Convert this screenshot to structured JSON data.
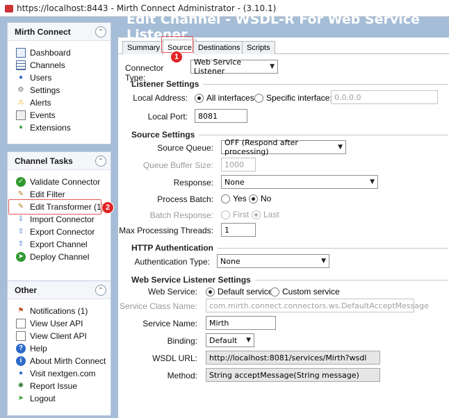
{
  "window": {
    "url": "https://localhost:8443",
    "separator": "-",
    "app_title": "Mirth Connect Administrator - (3.10.1)"
  },
  "sidebar": {
    "mirth_connect": {
      "title": "Mirth Connect",
      "items": [
        "Dashboard",
        "Channels",
        "Users",
        "Settings",
        "Alerts",
        "Events",
        "Extensions"
      ]
    },
    "channel_tasks": {
      "title": "Channel Tasks",
      "items": [
        "Validate Connector",
        "Edit Filter",
        "Edit Transformer (1)",
        "Import Connector",
        "Export Connector",
        "Export Channel",
        "Deploy Channel"
      ]
    },
    "other": {
      "title": "Other",
      "items": [
        "Notifications (1)",
        "View User API",
        "View Client API",
        "Help",
        "About Mirth Connect",
        "Visit nextgen.com",
        "Report Issue",
        "Logout"
      ]
    }
  },
  "annotations": {
    "badge1": "1",
    "badge2": "2"
  },
  "header": {
    "title": "Edit Channel - WSDL-R For Web Service Listener"
  },
  "tabs": [
    "Summary",
    "Source",
    "Destinations",
    "Scripts"
  ],
  "form": {
    "connector_type_label": "Connector Type:",
    "connector_type_value": "Web Service Listener",
    "listener_settings": "Listener Settings",
    "local_address_label": "Local Address:",
    "all_interfaces": "All interfaces",
    "specific_interface": "Specific interface:",
    "specific_interface_value": "0.0.0.0",
    "local_port_label": "Local Port:",
    "local_port_value": "8081",
    "source_settings": "Source Settings",
    "source_queue_label": "Source Queue:",
    "source_queue_value": "OFF (Respond after processing)",
    "queue_buffer_label": "Queue Buffer Size:",
    "queue_buffer_value": "1000",
    "response_label": "Response:",
    "response_value": "None",
    "process_batch_label": "Process Batch:",
    "yes": "Yes",
    "no": "No",
    "batch_response_label": "Batch Response:",
    "first": "First",
    "last": "Last",
    "max_threads_label": "Max Processing Threads:",
    "max_threads_value": "1",
    "http_auth": "HTTP Authentication",
    "auth_type_label": "Authentication Type:",
    "auth_type_value": "None",
    "ws_listener_settings": "Web Service Listener Settings",
    "web_service_label": "Web Service:",
    "default_service": "Default service",
    "custom_service": "Custom service",
    "service_class_label": "Service Class Name:",
    "service_class_value": "com.mirth.connect.connectors.ws.DefaultAcceptMessage",
    "service_name_label": "Service Name:",
    "service_name_value": "Mirth",
    "binding_label": "Binding:",
    "binding_value": "Default",
    "wsdl_url_label": "WSDL URL:",
    "wsdl_url_value": "http://localhost:8081/services/Mirth?wsdl",
    "method_label": "Method:",
    "method_value": "String acceptMessage(String message)"
  }
}
